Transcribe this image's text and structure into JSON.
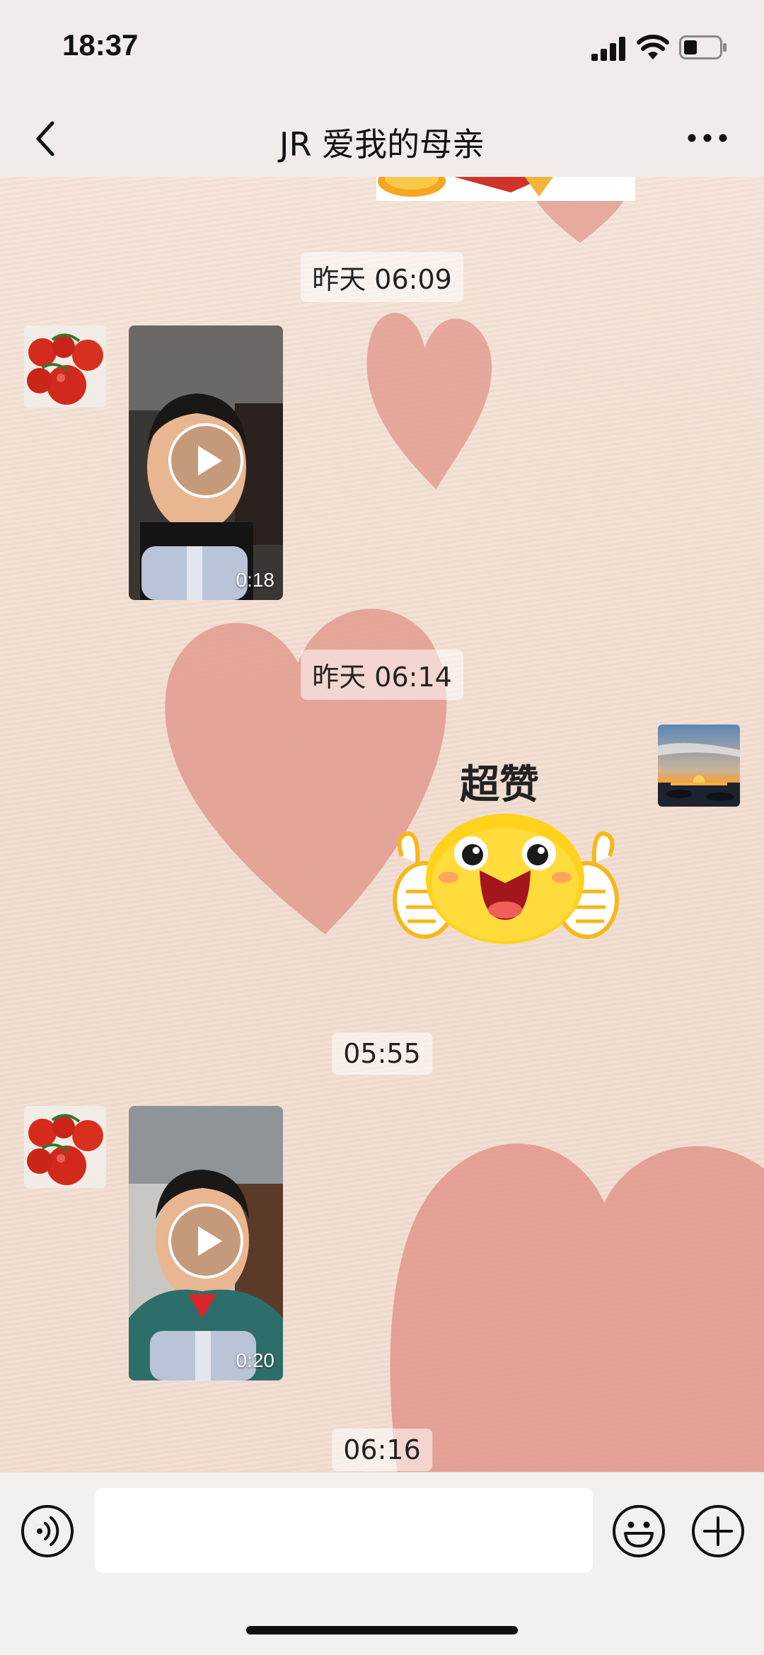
{
  "status_bar": {
    "time": "18:37"
  },
  "header": {
    "title": "JR 爱我的母亲"
  },
  "messages": [
    {
      "type": "timestamp",
      "text": "昨天 06:09"
    },
    {
      "type": "video",
      "sender": "contact",
      "avatar_icon": "tomatoes-icon",
      "duration": "0:18"
    },
    {
      "type": "timestamp",
      "text": "昨天 06:14"
    },
    {
      "type": "sticker",
      "sender": "self",
      "avatar_icon": "sunset-icon",
      "sticker_icon": "thumbs-up-smiley-icon",
      "caption": "超赞"
    },
    {
      "type": "timestamp",
      "text": "05:55"
    },
    {
      "type": "video",
      "sender": "contact",
      "avatar_icon": "tomatoes-icon",
      "duration": "0:20"
    },
    {
      "type": "timestamp",
      "text": "06:16"
    }
  ],
  "input_bar": {
    "placeholder": "",
    "left_icon": "voice-icon",
    "right_icons": [
      "emoji-icon",
      "plus-icon"
    ]
  },
  "colors": {
    "chat_background": "#f2dfd3",
    "heart": "#e29b8e",
    "bar_background": "#f1ecea"
  }
}
